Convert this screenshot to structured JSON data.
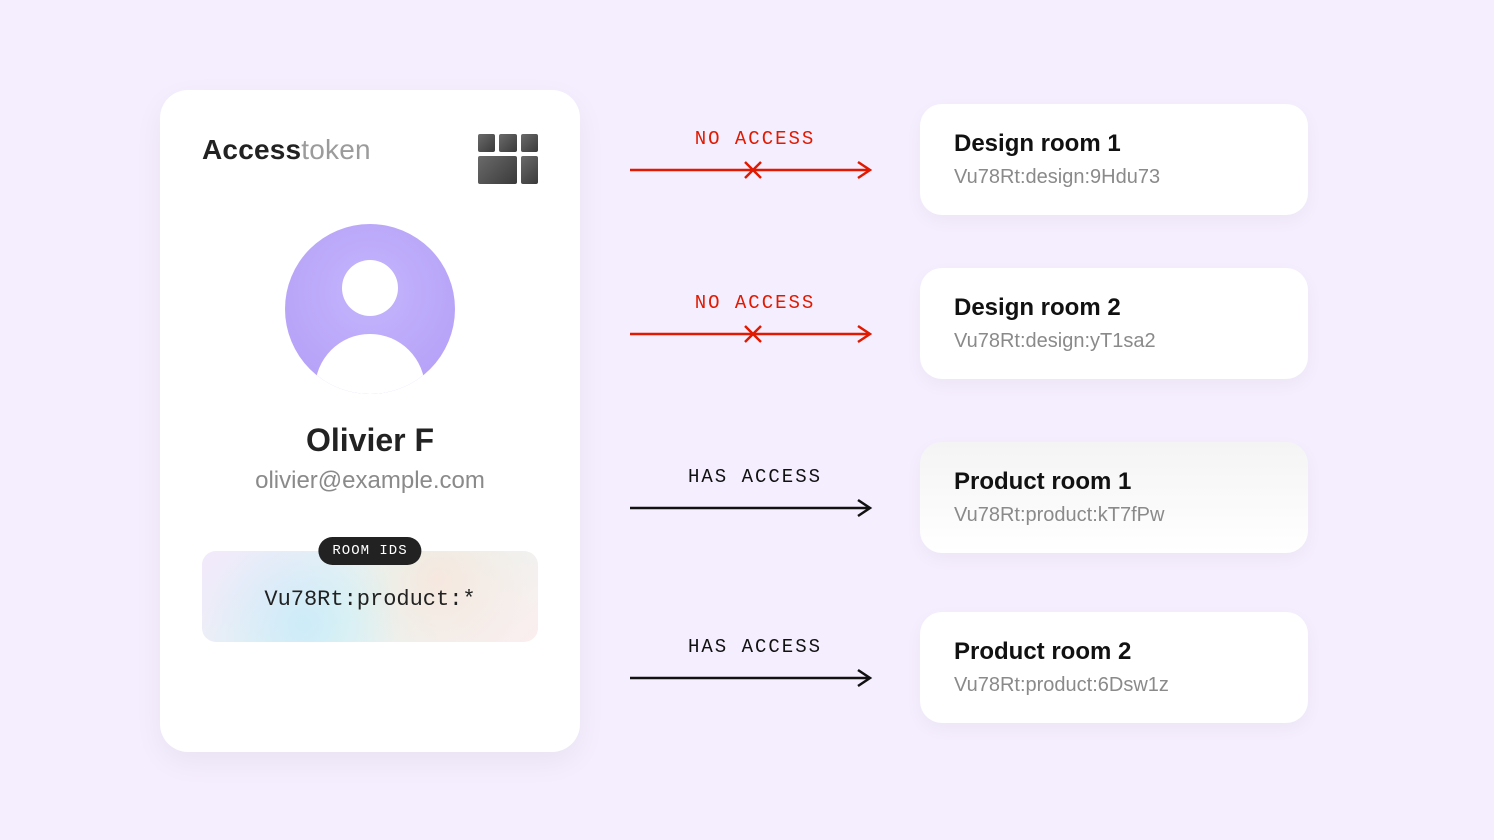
{
  "token": {
    "title_bold": "Access",
    "title_light": "token",
    "user_name": "Olivier F",
    "user_email": "olivier@example.com",
    "roomids_badge": "ROOM IDS",
    "roomids_value": "Vu78Rt:product:*"
  },
  "access": {
    "deny_label": "NO ACCESS",
    "allow_label": "HAS ACCESS"
  },
  "rooms": [
    {
      "title": "Design room 1",
      "id": "Vu78Rt:design:9Hdu73"
    },
    {
      "title": "Design room 2",
      "id": "Vu78Rt:design:yT1sa2"
    },
    {
      "title": "Product room 1",
      "id": "Vu78Rt:product:kT7fPw"
    },
    {
      "title": "Product room 2",
      "id": "Vu78Rt:product:6Dsw1z"
    }
  ],
  "colors": {
    "deny": "#e11900",
    "allow": "#111111"
  }
}
